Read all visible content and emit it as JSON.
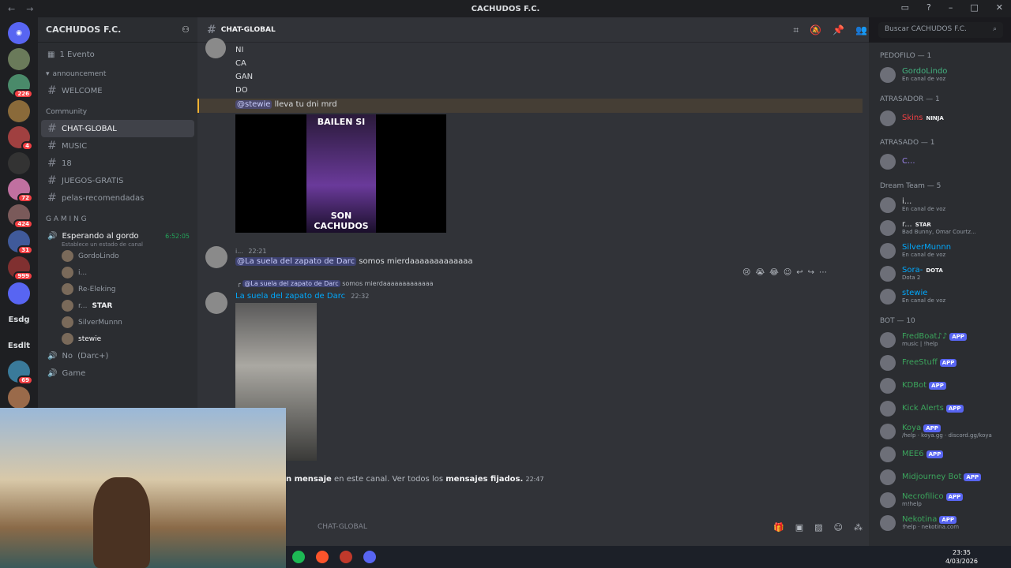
{
  "window": {
    "title": "CACHUDOS F.C."
  },
  "servers": [
    {
      "badge": ""
    },
    {
      "badge": "226"
    },
    {
      "badge": ""
    },
    {
      "badge": "4"
    },
    {
      "badge": ""
    },
    {
      "badge": "72"
    },
    {
      "badge": "424"
    },
    {
      "badge": "31"
    },
    {
      "badge": "999"
    },
    {
      "badge": ""
    },
    {
      "label": "Esdg"
    },
    {
      "label": "Esdlt"
    },
    {
      "badge": "69"
    },
    {
      "badge": ""
    }
  ],
  "sidebar": {
    "guild_name": "CACHUDOS F.C.",
    "events": "1 Evento",
    "category_announcement": "announcement",
    "channel_welcome": "WELCOME",
    "category_community": "Community",
    "channel_chat_global": "CHAT-GLOBAL",
    "channel_music": "MUSIC",
    "channel_18": "18",
    "channel_juegos": "JUEGOS-GRATIS",
    "channel_pelas": "pelas-recomendadas",
    "category_gaming": "G A M I N G",
    "voice_channel": "Esperando al gordo",
    "voice_timer": "6:52:05",
    "voice_status": "Establece un estado de canal",
    "voice_users": [
      "GordoLindo",
      "i...",
      "Re-Eleking",
      "r...",
      "SilverMunnn",
      "stewie"
    ],
    "voice_user_tag": "STAR",
    "voice_channel_2": "No",
    "voice_channel_2_note": "(Darc+)",
    "voice_channel_3": "Game"
  },
  "chat": {
    "channel_name": "CHAT-GLOBAL",
    "search_placeholder": "Buscar",
    "search_scope": "CACHUDOS F.C.",
    "lines": [
      "NI",
      "CA",
      "GAN",
      "DO"
    ],
    "mention_stewie": "@stewie",
    "msg_dni": "lleva tu dni mrd",
    "gif_top": "BAILEN SI",
    "gif_bottom": "SON CACHUDOS",
    "msg2_author": "i...",
    "msg2_time": "22:21",
    "msg2_mention": "@La suela del zapato de Darc",
    "msg2_text": "somos mierdaaaaaaaaaaaaa",
    "reply_mention": "@La suela del zapato de Darc",
    "reply_text": "somos mierdaaaaaaaaaaaaa",
    "msg3_author": "La suela del zapato de Darc",
    "msg3_time": "22:32",
    "pinned_pre": "n mensaje",
    "pinned_mid": "en este canal. Ver todos los",
    "pinned_link": "mensajes fijados.",
    "pinned_time": "22:47",
    "composer_channel": "CHAT-GLOBAL"
  },
  "members": {
    "groups": [
      {
        "title": "PEDOFILO — 1",
        "users": [
          {
            "name": "GordoLindo",
            "sub": "En canal de voz",
            "color": "#43b581"
          }
        ]
      },
      {
        "title": "ATRASADOR — 1",
        "users": [
          {
            "name": "Skins",
            "sub": "",
            "tag": "NINJA",
            "color": "#f23f43"
          }
        ]
      },
      {
        "title": "ATRASADO — 1",
        "users": [
          {
            "name": "C...",
            "sub": "",
            "color": "#9b84ec"
          }
        ]
      },
      {
        "title": "Dream Team — 5",
        "users": [
          {
            "name": "i...",
            "sub": "En canal de voz",
            "color": "#dbdee1"
          },
          {
            "name": "r...",
            "sub": "Bad Bunny, Omar Courtz...",
            "tag": "STAR",
            "color": "#dbdee1"
          },
          {
            "name": "SilverMunnn",
            "sub": "En canal de voz",
            "color": "#00a8fc"
          },
          {
            "name": "Sora-",
            "sub": "Dota 2",
            "tag": "DOTA",
            "color": "#00a8fc"
          },
          {
            "name": "stewie",
            "sub": "En canal de voz",
            "color": "#00a8fc"
          }
        ]
      },
      {
        "title": "BOT — 10",
        "users": [
          {
            "name": "FredBoat♪♪",
            "sub": "music | !help",
            "app": "APP",
            "color": "#3ba55c"
          },
          {
            "name": "FreeStuff",
            "sub": "",
            "app": "APP",
            "color": "#3ba55c"
          },
          {
            "name": "KDBot",
            "sub": "",
            "app": "APP",
            "color": "#3ba55c"
          },
          {
            "name": "Kick Alerts",
            "sub": "",
            "app": "APP",
            "color": "#3ba55c"
          },
          {
            "name": "Koya",
            "sub": "/help · koya.gg · discord.gg/koya",
            "app": "APP",
            "color": "#3ba55c"
          },
          {
            "name": "MEE6",
            "sub": "",
            "app": "APP",
            "color": "#3ba55c"
          },
          {
            "name": "Midjourney Bot",
            "sub": "",
            "app": "APP",
            "color": "#3ba55c"
          },
          {
            "name": "Necrofilico",
            "sub": "m!help",
            "app": "APP",
            "color": "#3ba55c"
          },
          {
            "name": "Nekotina",
            "sub": "!help · nekotina.com",
            "app": "APP",
            "color": "#3ba55c"
          }
        ]
      }
    ]
  },
  "taskbar": {
    "time": "23:35",
    "date": "4/03/2026"
  }
}
